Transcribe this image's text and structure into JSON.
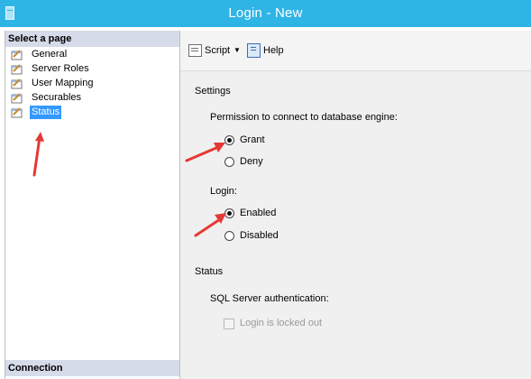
{
  "window": {
    "title": "Login - New"
  },
  "sidebar": {
    "header": "Select a page",
    "items": [
      {
        "label": "General"
      },
      {
        "label": "Server Roles"
      },
      {
        "label": "User Mapping"
      },
      {
        "label": "Securables"
      },
      {
        "label": "Status",
        "selected": true
      }
    ],
    "connection_header": "Connection"
  },
  "toolbar": {
    "script_label": "Script",
    "help_label": "Help"
  },
  "form": {
    "settings_label": "Settings",
    "permission_label": "Permission to connect to database engine:",
    "permission_options": [
      {
        "label": "Grant",
        "checked": true
      },
      {
        "label": "Deny",
        "checked": false
      }
    ],
    "login_label": "Login:",
    "login_options": [
      {
        "label": "Enabled",
        "checked": true
      },
      {
        "label": "Disabled",
        "checked": false
      }
    ],
    "status_label": "Status",
    "sql_auth_label": "SQL Server authentication:",
    "locked_out_label": "Login is locked out",
    "locked_out_checked": false
  },
  "colors": {
    "titlebar": "#2fb4e6",
    "selection": "#3399ff",
    "annotation_arrow": "#e53935"
  }
}
